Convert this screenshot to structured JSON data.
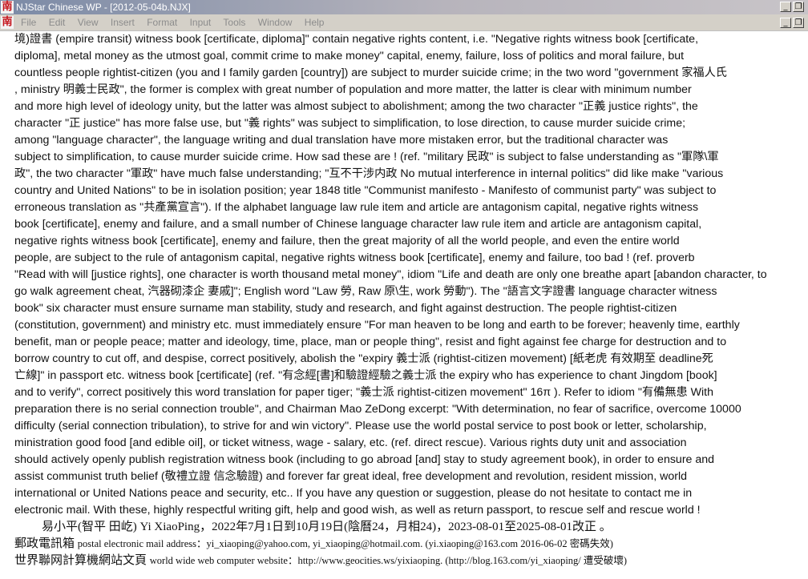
{
  "window": {
    "title": "NJStar Chinese WP - [2012-05-04b.NJX]",
    "app_icon_glyph": "南",
    "title_bar_colors": [
      "#7b8aa6",
      "#c8c4c8"
    ],
    "menu": [
      "File",
      "Edit",
      "View",
      "Insert",
      "Format",
      "Input",
      "Tools",
      "Window",
      "Help"
    ],
    "controls": {
      "minimize": "_",
      "restore": "❐"
    }
  },
  "document": {
    "body_lines": [
      "境)證書 (empire transit) witness book [certificate, diploma]\" contain negative rights content, i.e. \"Negative rights witness book [certificate,",
      "diploma], metal money as the utmost goal, commit crime to make money\" capital,  enemy, failure, loss of politics and moral failure, but",
      "countless people rightist-citizen (you and I family garden [country]) are subject to murder suicide crime; in the two word \"government 家福人氏",
      ", ministry 明義士民政\", the former is complex with great number of population and more matter, the latter is clear with minimum number",
      "and more high level of ideology unity, but the latter was almost subject to abolishment; among the two character \"正義 justice rights\", the",
      "character \"正  justice\" has more false use, but \"義  rights\" was subject to simplification, to lose direction, to cause murder suicide crime;",
      "among \"language character\", the language writing and dual translation have more mistaken error, but the traditional character was",
      "subject to simplification, to cause murder suicide crime.  How sad these are ! (ref. \"military 民政\" is subject to false understanding as \"軍隊\\軍",
      "政\", the two character \"軍政\" have much false understanding; \"互不干涉内政 No mutual interference in internal politics\" did like make \"various",
      "country and United Nations\" to be in isolation position; year 1848 title \"Communist manifesto  - Manifesto of communist party\" was subject to",
      "erroneous translation as \"共產黨宣言\").  If the alphabet language law rule item and article are antagonism capital, negative rights witness",
      "book [certificate], enemy and failure, and a small number of Chinese language character law rule item and article are antagonism capital,",
      "negative rights witness book [certificate], enemy and failure,  then the great majority of all the world people, and even the entire world",
      "people, are subject to the rule of antagonism capital, negative rights witness book [certificate], enemy and failure, too bad ! (ref. proverb",
      "\"Read with will [justice rights], one character is worth thousand metal money\", idiom \"Life and death are only one breathe apart [abandon character, to",
      "go walk agreement cheat, 汽器砌漆企 妻戚]\"; English word \"Law 勞, Raw 原\\生, work 勞動\").  The \"語言文字證書 language character witness",
      "book\" six character must ensure surname man stability, study and research, and fight against destruction.  The people rightist-citizen",
      "(constitution, government) and ministry etc. must immediately ensure \"For man heaven to be long and earth to be forever; heavenly time, earthly",
      "benefit, man or people peace;  matter and ideology, time, place, man or people thing\", resist and fight against fee charge for destruction and to",
      "borrow country to cut off, and despise, correct positively, abolish the \"expiry 義士派 (rightist-citizen movement) [紙老虎 有效期至 deadline死",
      "亡線]\" in passport etc. witness book [certificate] (ref. \"有念經[書]和驗證經驗之義士派 the expiry who has experience to chant Jingdom [book]",
      "and to verify\", correct positively this word translation for paper tiger; \"義士派 rightist-citizen movement\" 16π ).  Refer to idiom \"有備無患 With",
      "preparation there is no serial connection trouble\", and Chairman Mao ZeDong excerpt: \"With determination, no fear of sacrifice, overcome 10000",
      "difficulty (serial connection tribulation), to strive for and win victory\".  Please use the world postal service to post book or letter, scholarship,",
      "ministration good food [and edible oil], or ticket witness, wage - salary, etc. (ref. direct rescue).  Various rights duty unit and association",
      "should actively openly publish registration witness book (including to go abroad [and] stay to study agreement book), in order to ensure and",
      "assist communist truth belief (敬禮立證 信念驗證) and forever far great ideal, free development and revolution, resident mission, world",
      "international or United Nations peace and security, etc..  If you have any question or suggestion, please do not hesitate to contact me in",
      "electronic mail. With these, highly respectful writing gift, help and good wish, as well as return passport, to rescue self and rescue world !"
    ],
    "signature": "易小平(智平 田屹) Yi XiaoPing，2022年7月1日到10月19日(陰曆24，月相24)，2023-08-01至2025-08-01改正 。",
    "email_label": "郵政電訊箱",
    "email_text": "postal electronic mail address：yi_xiaoping@yahoo.com, yi_xiaoping@hotmail.com.  (yi.xiaoping@163.com 2016-06-02 密碼失效)",
    "website_label": "世界聯网計算機網站文頁",
    "website_text": "world wide web computer website：http://www.geocities.ws/yixiaoping. (http://blog.163.com/yi_xiaoping/ 遭受破壞)"
  }
}
